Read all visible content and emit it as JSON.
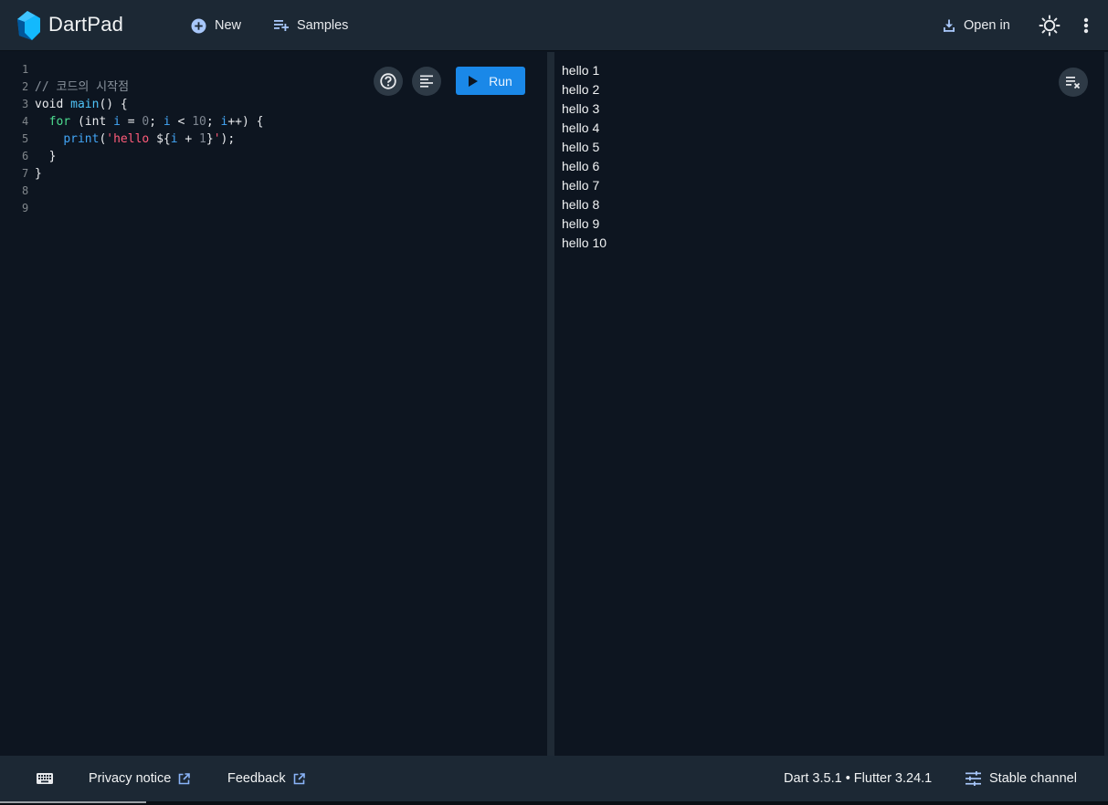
{
  "header": {
    "title": "DartPad",
    "new_label": "New",
    "samples_label": "Samples",
    "open_in_label": "Open in"
  },
  "editor": {
    "line_numbers": [
      "1",
      "2",
      "3",
      "4",
      "5",
      "6",
      "7",
      "8",
      "9"
    ],
    "lines": [
      "",
      "// 코드의 시작점",
      "void main() {",
      "  for (int i = 0; i < 10; i++) {",
      "    print('hello ${i + 1}');",
      "  }",
      "}",
      "",
      ""
    ],
    "run_label": "Run"
  },
  "output": {
    "lines": [
      "hello 1",
      "hello 2",
      "hello 3",
      "hello 4",
      "hello 5",
      "hello 6",
      "hello 7",
      "hello 8",
      "hello 9",
      "hello 10"
    ]
  },
  "footer": {
    "privacy_label": "Privacy notice",
    "feedback_label": "Feedback",
    "version_label": "Dart 3.5.1 • Flutter 3.24.1",
    "channel_label": "Stable channel"
  },
  "colors": {
    "accent": "#1a88e8",
    "background": "#0d1520",
    "header": "#1c2834"
  }
}
